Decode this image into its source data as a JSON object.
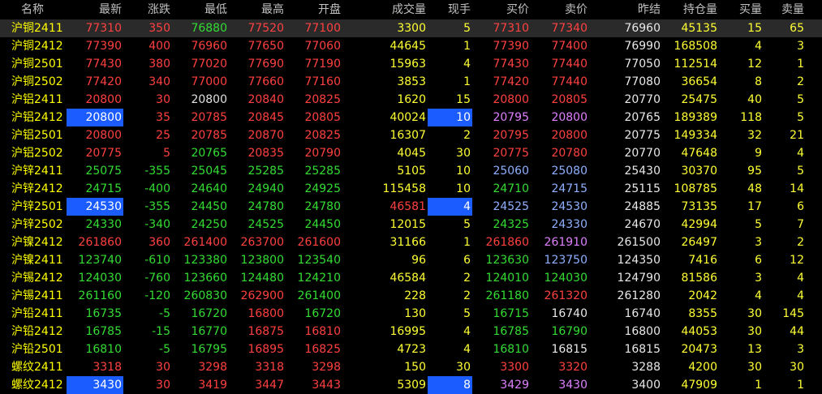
{
  "headers": [
    "名称",
    "最新",
    "涨跌",
    "最低",
    "最高",
    "开盘",
    "成交量",
    "现手",
    "买价",
    "卖价",
    "昨结",
    "持仓量",
    "买量",
    "卖量"
  ],
  "rows": [
    {
      "name": "沪铜2411",
      "last": "77310",
      "chg": "350",
      "low": "76880",
      "high": "77520",
      "open": "77100",
      "vol": "3300",
      "cur": "5",
      "bid": "77310",
      "ask": "77340",
      "pre": "76960",
      "oi": "45135",
      "bq": "15",
      "aq": "65"
    },
    {
      "name": "沪铜2412",
      "last": "77390",
      "chg": "400",
      "low": "76960",
      "high": "77650",
      "open": "77060",
      "vol": "44645",
      "cur": "1",
      "bid": "77390",
      "ask": "77400",
      "pre": "76990",
      "oi": "168508",
      "bq": "4",
      "aq": "3"
    },
    {
      "name": "沪铜2501",
      "last": "77430",
      "chg": "380",
      "low": "77020",
      "high": "77690",
      "open": "77190",
      "vol": "15963",
      "cur": "4",
      "bid": "77430",
      "ask": "77440",
      "pre": "77050",
      "oi": "112514",
      "bq": "12",
      "aq": "1"
    },
    {
      "name": "沪铜2502",
      "last": "77420",
      "chg": "340",
      "low": "77000",
      "high": "77660",
      "open": "77160",
      "vol": "3853",
      "cur": "1",
      "bid": "77420",
      "ask": "77440",
      "pre": "77080",
      "oi": "36654",
      "bq": "8",
      "aq": "2"
    },
    {
      "name": "沪铝2411",
      "last": "20800",
      "chg": "30",
      "low": "20800",
      "high": "20840",
      "open": "20825",
      "vol": "1620",
      "cur": "15",
      "bid": "20800",
      "ask": "20805",
      "pre": "20770",
      "oi": "25475",
      "bq": "40",
      "aq": "5"
    },
    {
      "name": "沪铝2412",
      "last": "20800",
      "chg": "35",
      "low": "20785",
      "high": "20845",
      "open": "20805",
      "vol": "40024",
      "cur": "10",
      "bid": "20795",
      "ask": "20800",
      "pre": "20765",
      "oi": "189389",
      "bq": "118",
      "aq": "5"
    },
    {
      "name": "沪铝2501",
      "last": "20800",
      "chg": "25",
      "low": "20785",
      "high": "20870",
      "open": "20825",
      "vol": "16307",
      "cur": "2",
      "bid": "20795",
      "ask": "20800",
      "pre": "20775",
      "oi": "149334",
      "bq": "32",
      "aq": "21"
    },
    {
      "name": "沪铝2502",
      "last": "20775",
      "chg": "5",
      "low": "20765",
      "high": "20835",
      "open": "20790",
      "vol": "4045",
      "cur": "30",
      "bid": "20775",
      "ask": "20780",
      "pre": "20770",
      "oi": "47648",
      "bq": "9",
      "aq": "4"
    },
    {
      "name": "沪锌2411",
      "last": "25075",
      "chg": "-355",
      "low": "25045",
      "high": "25285",
      "open": "25285",
      "vol": "5105",
      "cur": "10",
      "bid": "25060",
      "ask": "25080",
      "pre": "25430",
      "oi": "30370",
      "bq": "95",
      "aq": "5"
    },
    {
      "name": "沪锌2412",
      "last": "24715",
      "chg": "-400",
      "low": "24640",
      "high": "24940",
      "open": "24925",
      "vol": "115458",
      "cur": "10",
      "bid": "24710",
      "ask": "24715",
      "pre": "25115",
      "oi": "108785",
      "bq": "48",
      "aq": "14"
    },
    {
      "name": "沪锌2501",
      "last": "24530",
      "chg": "-355",
      "low": "24450",
      "high": "24780",
      "open": "24780",
      "vol": "46581",
      "cur": "4",
      "bid": "24525",
      "ask": "24530",
      "pre": "24885",
      "oi": "73135",
      "bq": "17",
      "aq": "6"
    },
    {
      "name": "沪锌2502",
      "last": "24330",
      "chg": "-340",
      "low": "24250",
      "high": "24525",
      "open": "24450",
      "vol": "12015",
      "cur": "5",
      "bid": "24325",
      "ask": "24330",
      "pre": "24670",
      "oi": "42994",
      "bq": "5",
      "aq": "7"
    },
    {
      "name": "沪镍2412",
      "last": "261860",
      "chg": "360",
      "low": "261400",
      "high": "263700",
      "open": "261600",
      "vol": "31166",
      "cur": "1",
      "bid": "261860",
      "ask": "261910",
      "pre": "261500",
      "oi": "26497",
      "bq": "3",
      "aq": "2"
    },
    {
      "name": "沪镍2411",
      "last": "123740",
      "chg": "-610",
      "low": "123380",
      "high": "123800",
      "open": "123540",
      "vol": "96",
      "cur": "6",
      "bid": "123630",
      "ask": "123750",
      "pre": "124350",
      "oi": "7416",
      "bq": "6",
      "aq": "12"
    },
    {
      "name": "沪锡2412",
      "last": "124030",
      "chg": "-760",
      "low": "123660",
      "high": "124480",
      "open": "124210",
      "vol": "46584",
      "cur": "2",
      "bid": "124010",
      "ask": "124030",
      "pre": "124790",
      "oi": "81586",
      "bq": "3",
      "aq": "4"
    },
    {
      "name": "沪锡2411",
      "last": "261160",
      "chg": "-120",
      "low": "260830",
      "high": "262900",
      "open": "261400",
      "vol": "228",
      "cur": "2",
      "bid": "261180",
      "ask": "261320",
      "pre": "261280",
      "oi": "2042",
      "bq": "4",
      "aq": "4"
    },
    {
      "name": "沪铅2411",
      "last": "16735",
      "chg": "-5",
      "low": "16720",
      "high": "16800",
      "open": "16720",
      "vol": "130",
      "cur": "5",
      "bid": "16715",
      "ask": "16740",
      "pre": "16740",
      "oi": "8355",
      "bq": "30",
      "aq": "145"
    },
    {
      "name": "沪铅2412",
      "last": "16785",
      "chg": "-15",
      "low": "16770",
      "high": "16875",
      "open": "16810",
      "vol": "16995",
      "cur": "4",
      "bid": "16785",
      "ask": "16790",
      "pre": "16800",
      "oi": "44053",
      "bq": "30",
      "aq": "44"
    },
    {
      "name": "沪铅2501",
      "last": "16810",
      "chg": "-5",
      "low": "16795",
      "high": "16895",
      "open": "16825",
      "vol": "4723",
      "cur": "4",
      "bid": "16810",
      "ask": "16815",
      "pre": "16815",
      "oi": "20473",
      "bq": "13",
      "aq": "3"
    },
    {
      "name": "螺纹2411",
      "last": "3318",
      "chg": "30",
      "low": "3298",
      "high": "3318",
      "open": "3298",
      "vol": "150",
      "cur": "30",
      "bid": "3300",
      "ask": "3320",
      "pre": "3288",
      "oi": "4200",
      "bq": "30",
      "aq": "30"
    },
    {
      "name": "螺纹2412",
      "last": "3430",
      "chg": "30",
      "low": "3419",
      "high": "3447",
      "open": "3443",
      "vol": "5309",
      "cur": "8",
      "bid": "3429",
      "ask": "3430",
      "pre": "3400",
      "oi": "47909",
      "bq": "1",
      "aq": "1"
    }
  ],
  "colors": {
    "up": "#ff4040",
    "down": "#33dd33",
    "highlight": "#1a5cff",
    "name": "#ffff00"
  }
}
